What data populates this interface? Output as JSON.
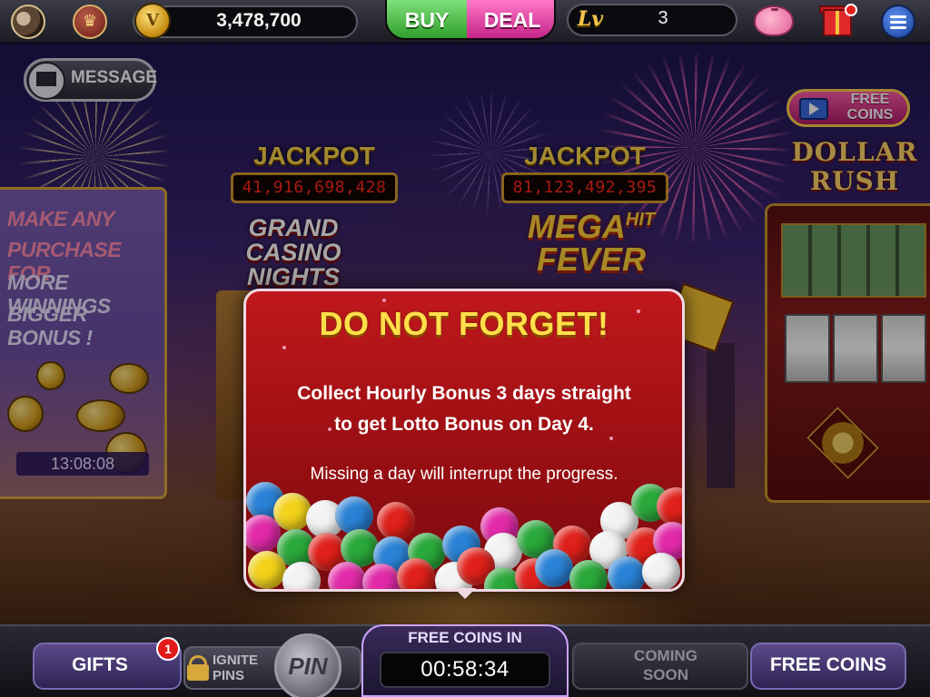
{
  "topbar": {
    "balance": "3,478,700",
    "coin_symbol": "V",
    "buy_label": "BUY",
    "deal_label": "DEAL",
    "level_prefix": "Lv",
    "level_value": "3",
    "icons": [
      "avatar",
      "crown-icon",
      "coin-icon",
      "piggy-bank-icon",
      "gift-icon",
      "menu-icon"
    ]
  },
  "message_button": {
    "label": "MESSAGE",
    "icon": "envelope-icon"
  },
  "promo": {
    "lines": [
      "MAKE ANY",
      "PURCHASE FOR",
      "MORE WINNINGS",
      "BIGGER BONUS !"
    ],
    "timer": "13:08:08"
  },
  "games": [
    {
      "jackpot_label": "JACKPOT",
      "jackpot_amount": "41,916,698,428",
      "logo_lines": [
        "GRAND",
        "CASINO",
        "NIGHTS"
      ]
    },
    {
      "jackpot_label": "JACKPOT",
      "jackpot_amount": "81,123,492,395",
      "logo_main": "MEGA",
      "logo_hit": "HIT",
      "logo_second": "FEVER"
    },
    {
      "free_coins_line1": "FREE",
      "free_coins_line2": "COINS",
      "logo_lines": [
        "DOLLAR",
        "RUSH"
      ]
    }
  ],
  "modal": {
    "title": "DO NOT FORGET!",
    "line1": "Collect Hourly Bonus 3 days straight",
    "line2": "to get Lotto Bonus on Day 4.",
    "line3": "Missing a day will interrupt the progress."
  },
  "bottombar": {
    "gifts_label": "GIFTS",
    "gifts_badge": "1",
    "ignite_line1": "IGNITE",
    "ignite_line2": "PINS",
    "pin_label": "PIN",
    "free_coins_in_label": "FREE COINS IN",
    "free_coins_timer": "00:58:34",
    "coming_line1": "COMING",
    "coming_line2": "SOON",
    "free_coins_label": "FREE COINS"
  },
  "colors": {
    "buy": "#2d9b2a",
    "deal": "#c22086",
    "modal_bg": "#a01014",
    "modal_title": "#ffde4a",
    "jackpot_digits": "#ff2a1a"
  }
}
